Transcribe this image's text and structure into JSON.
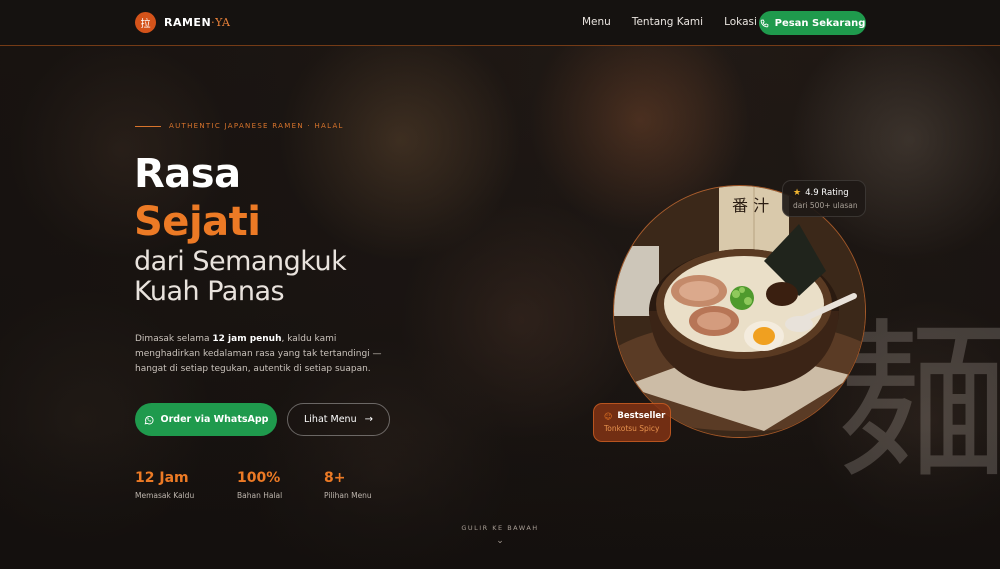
{
  "nav": {
    "logo_mark": "拉",
    "logo_name": "RAMEN",
    "logo_accent": "·YA",
    "links": [
      "Menu",
      "Tentang Kami",
      "Lokasi"
    ],
    "cta_label": "Pesan Sekarang"
  },
  "hero": {
    "eyebrow": "AUTHENTIC JAPANESE RAMEN · HALAL",
    "title_line1": "Rasa",
    "title_line2": "Sejati",
    "title_line3": "dari Semangkuk",
    "title_line4": "Kuah Panas",
    "desc_before": "Dimasak selama ",
    "desc_bold": "12 jam penuh",
    "desc_after": ", kaldu kami menghadirkan kedalaman rasa yang tak tertandingi — hangat di setiap tegukan, autentik di setiap suapan.",
    "btn_whatsapp": "Order via WhatsApp",
    "btn_menu": "Lihat Menu",
    "stats": [
      {
        "value": "12 Jam",
        "label": "Memasak Kaldu"
      },
      {
        "value": "100%",
        "label": "Bahan Halal"
      },
      {
        "value": "8+",
        "label": "Pilihan Menu"
      }
    ],
    "scroll_hint": "GULIR KE BAWAH"
  },
  "visual": {
    "rating_title": "4.9 Rating",
    "rating_sub": "dari 500+ ulasan",
    "best_title": "Bestseller",
    "best_sub": "Tonkotsu Spicy",
    "kanji": "麺",
    "noren_text": "番 汁"
  },
  "colors": {
    "accent": "#ec7a25",
    "whatsapp_green": "#1f9a4d",
    "background": "#1a1614"
  },
  "icons": [
    "phone-icon",
    "whatsapp-icon",
    "arrow-right-icon",
    "star-icon",
    "fire-icon",
    "chevron-down-icon"
  ]
}
